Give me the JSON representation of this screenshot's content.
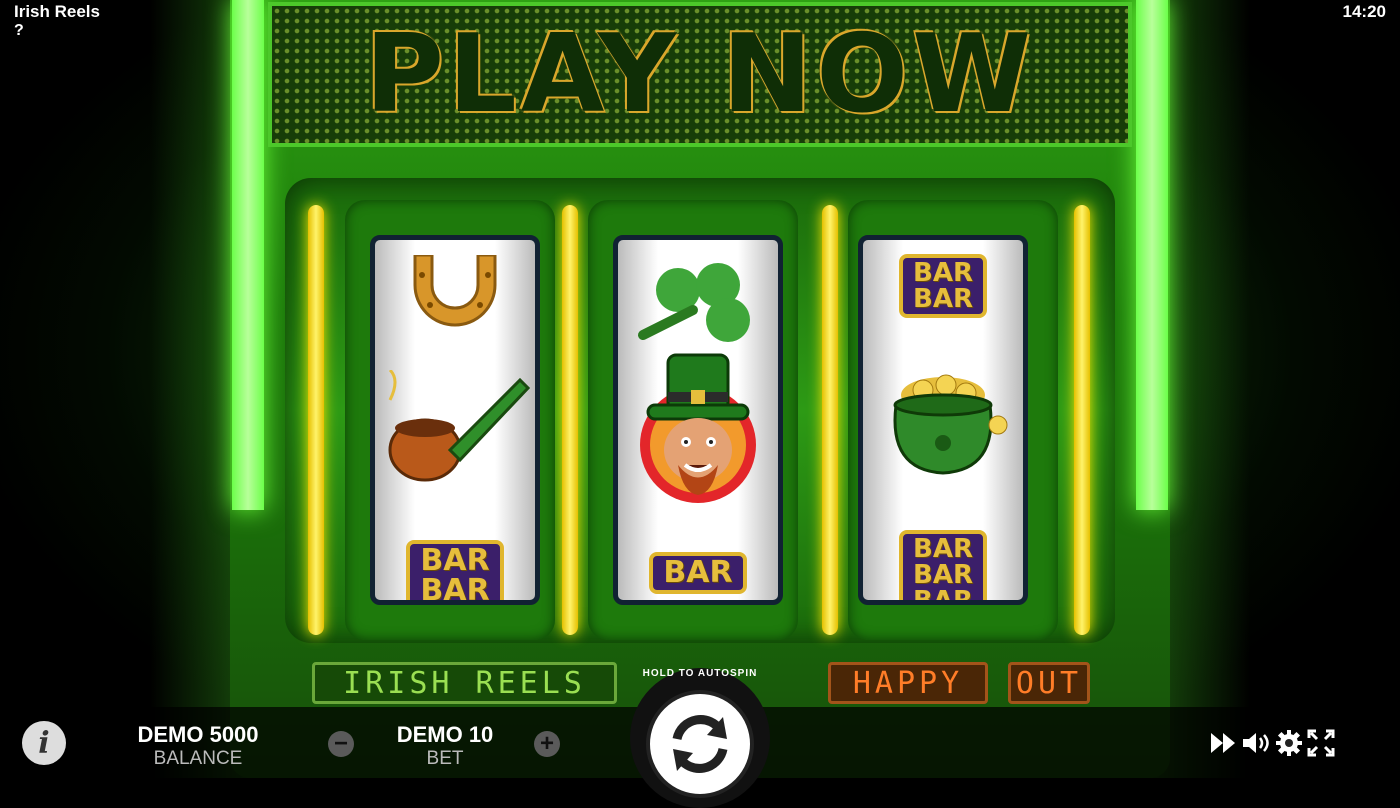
{
  "header": {
    "title": "Irish Reels",
    "help": "?",
    "clock": "14:20"
  },
  "marquee": {
    "text": "PLAY NOW"
  },
  "reels": [
    {
      "symbols": [
        "horseshoe-icon",
        "pipe-icon",
        "double-bar"
      ]
    },
    {
      "symbols": [
        "clover-icon",
        "leprechaun-icon",
        "single-bar"
      ]
    },
    {
      "symbols": [
        "double-bar",
        "pot-of-gold-icon",
        "triple-bar"
      ]
    }
  ],
  "bar": {
    "label": "BAR"
  },
  "plates": {
    "left": "IRISH REELS",
    "mid": "HAPPY",
    "right": "OUT"
  },
  "hud": {
    "info": "i",
    "balance_value": "DEMO 5000",
    "balance_label": "BALANCE",
    "bet_value": "DEMO 10",
    "bet_label": "BET",
    "minus": "−",
    "plus": "+",
    "hold_to_autospin": "HOLD TO AUTOSPIN"
  },
  "colors": {
    "cabinet": "#2fa114",
    "bulb": "#fff36a",
    "bar_bg": "#3b1f6a",
    "bar_gold": "#e6be3c"
  }
}
